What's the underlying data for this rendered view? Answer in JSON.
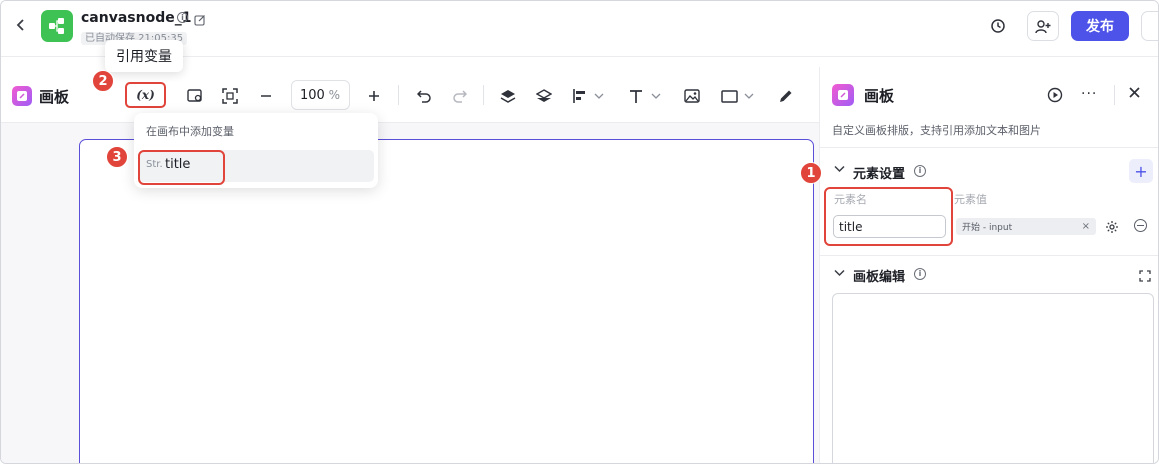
{
  "header": {
    "back_icon": "chevron-left-icon",
    "app_icon": "workflow-node-icon",
    "app_color": "#3ec254",
    "title": "canvasnode_1",
    "autosave": "已自动保存 21:05:35",
    "publish_label": "发布",
    "accent": "#4d53e8"
  },
  "tooltip": {
    "text": "引用变量"
  },
  "toolbar": {
    "panel_title": "画板",
    "variable_label": "(x)",
    "zoom_value": "100",
    "zoom_unit": "%"
  },
  "dropdown": {
    "header": "在画布中添加变量",
    "items": [
      {
        "type": "Str.",
        "name": "title"
      }
    ]
  },
  "steps": [
    "1",
    "2",
    "3"
  ],
  "right_panel": {
    "title": "画板",
    "description": "自定义画板排版，支持引用添加文本和图片",
    "element_section": {
      "title": "元素设置",
      "col_name": "元素名",
      "col_value": "元素值",
      "name_value": "title",
      "value_tag": "开始 - input"
    },
    "editor_section": {
      "title": "画板编辑"
    }
  },
  "highlight_color": "#e1443a"
}
